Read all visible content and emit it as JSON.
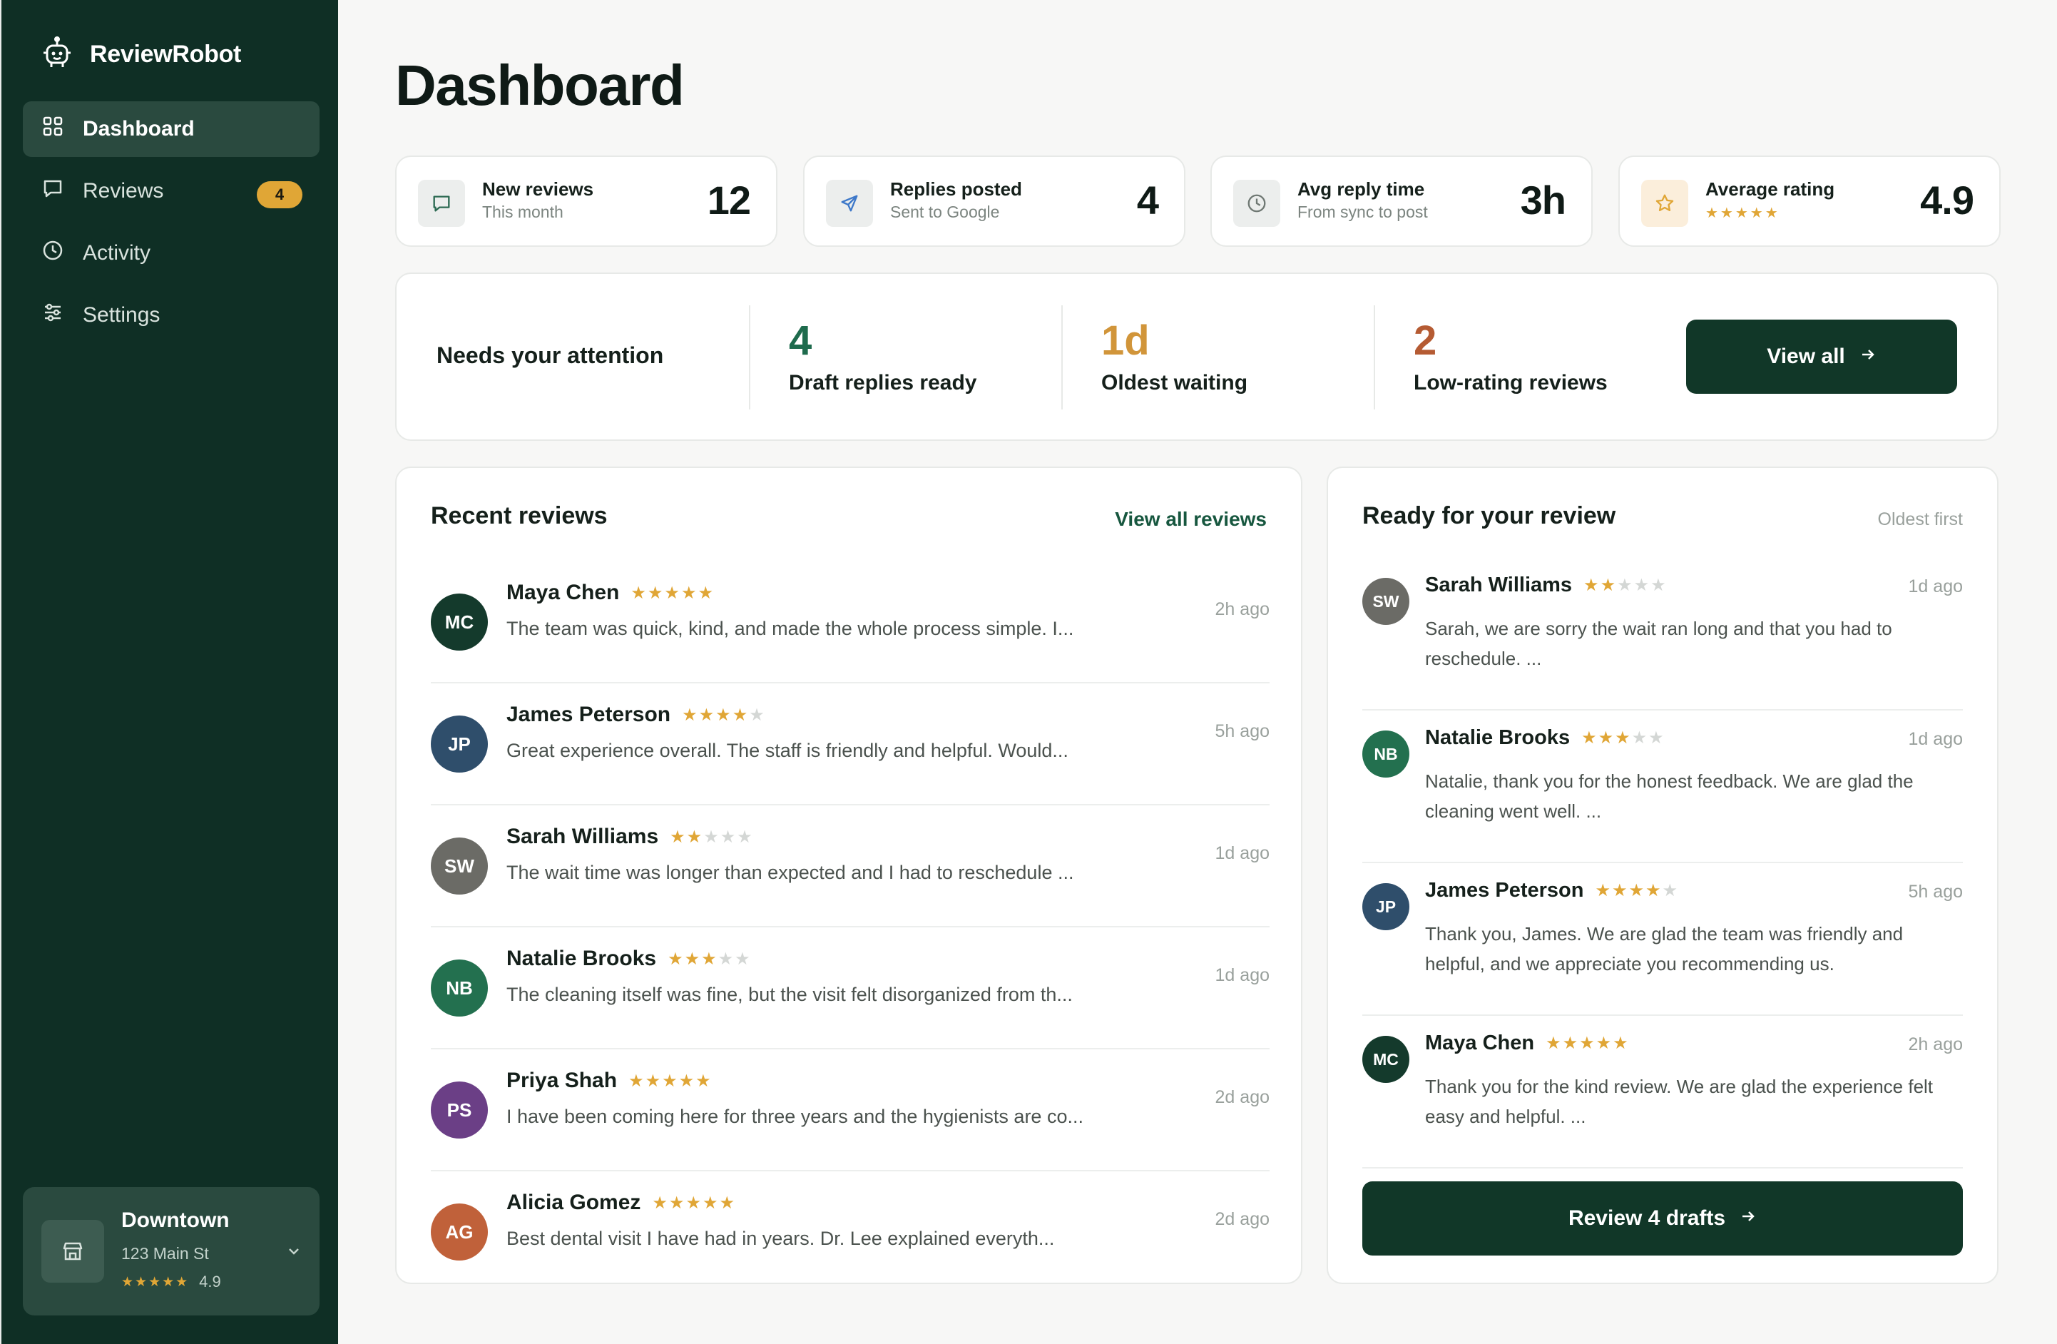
{
  "app": {
    "name": "ReviewRobot"
  },
  "sidebar": {
    "items": [
      {
        "label": "Dashboard",
        "icon": "grid-icon",
        "active": true
      },
      {
        "label": "Reviews",
        "icon": "message-icon",
        "badge": "4"
      },
      {
        "label": "Activity",
        "icon": "clock-icon"
      },
      {
        "label": "Settings",
        "icon": "sliders-icon"
      }
    ],
    "location": {
      "name": "Downtown",
      "address": "123 Main St",
      "stars": "★★★★★",
      "rating": "4.9"
    }
  },
  "page": {
    "title": "Dashboard"
  },
  "stats": [
    {
      "label": "New reviews",
      "sub": "This month",
      "value": "12",
      "icon": "message-icon"
    },
    {
      "label": "Replies posted",
      "sub": "Sent to Google",
      "value": "4",
      "icon": "send-icon"
    },
    {
      "label": "Avg reply time",
      "sub": "From sync to post",
      "value": "3h",
      "icon": "clock-icon"
    },
    {
      "label": "Average rating",
      "sub": "★★★★★",
      "value": "4.9",
      "icon": "star-icon"
    }
  ],
  "attention": {
    "title": "Needs your attention",
    "metrics": [
      {
        "value": "4",
        "label": "Draft replies ready",
        "color": "#1e6b4d"
      },
      {
        "value": "1d",
        "label": "Oldest waiting",
        "color": "#d1953a"
      },
      {
        "value": "2",
        "label": "Low-rating reviews",
        "color": "#b55b33"
      }
    ],
    "button": "View all"
  },
  "recent": {
    "title": "Recent reviews",
    "link": "View all reviews",
    "rows": [
      {
        "initials": "MC",
        "avatar_color": "#143a2c",
        "name": "Maya Chen",
        "rating": 5,
        "text": "The team was quick, kind, and made the whole process simple. I...",
        "time": "2h ago"
      },
      {
        "initials": "JP",
        "avatar_color": "#2f4e6b",
        "name": "James Peterson",
        "rating": 4,
        "text": "Great experience overall. The staff is friendly and helpful. Would...",
        "time": "5h ago"
      },
      {
        "initials": "SW",
        "avatar_color": "#6b6b66",
        "name": "Sarah Williams",
        "rating": 2,
        "text": "The wait time was longer than expected and I had to reschedule ...",
        "time": "1d ago"
      },
      {
        "initials": "NB",
        "avatar_color": "#23704f",
        "name": "Natalie Brooks",
        "rating": 3,
        "text": "The cleaning itself was fine, but the visit felt disorganized from th...",
        "time": "1d ago"
      },
      {
        "initials": "PS",
        "avatar_color": "#6b3f86",
        "name": "Priya Shah",
        "rating": 5,
        "text": "I have been coming here for three years and the hygienists are co...",
        "time": "2d ago"
      },
      {
        "initials": "AG",
        "avatar_color": "#c0613a",
        "name": "Alicia Gomez",
        "rating": 5,
        "text": "Best dental visit I have had in years. Dr. Lee explained everyth...",
        "time": "2d ago"
      }
    ]
  },
  "drafts": {
    "title": "Ready for your review",
    "note": "Oldest first",
    "rows": [
      {
        "initials": "SW",
        "avatar_color": "#6b6b66",
        "name": "Sarah Williams",
        "rating": 2,
        "time": "1d ago",
        "text": "Sarah, we are sorry the wait ran long and that you had to reschedule. ..."
      },
      {
        "initials": "NB",
        "avatar_color": "#23704f",
        "name": "Natalie Brooks",
        "rating": 3,
        "time": "1d ago",
        "text": "Natalie, thank you for the honest feedback. We are glad the cleaning went well. ..."
      },
      {
        "initials": "JP",
        "avatar_color": "#2f4e6b",
        "name": "James Peterson",
        "rating": 4,
        "time": "5h ago",
        "text": "Thank you, James. We are glad the team was friendly and helpful, and we appreciate you recommending us."
      },
      {
        "initials": "MC",
        "avatar_color": "#143a2c",
        "name": "Maya Chen",
        "rating": 5,
        "time": "2h ago",
        "text": "Thank you for the kind review. We are glad the experience felt easy and helpful. ..."
      }
    ],
    "button": "Review 4 drafts"
  }
}
